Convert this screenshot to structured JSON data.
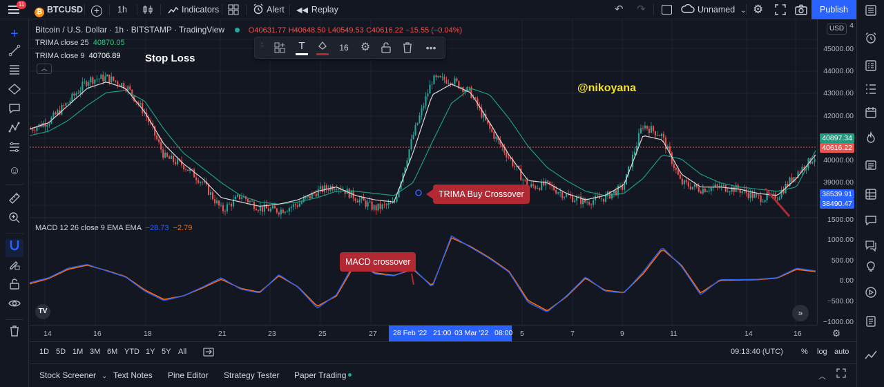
{
  "topbar": {
    "menu_badge": "11",
    "symbol": "BTCUSD",
    "interval": "1h",
    "indicators_label": "Indicators",
    "alert_label": "Alert",
    "replay_label": "Replay",
    "layout_name": "Unnamed",
    "publish_label": "Publish"
  },
  "legend": {
    "title": "Bitcoin / U.S. Dollar · 1h · BITSTAMP · TradingView",
    "open": "O40631.77",
    "high": "H40648.50",
    "low": "L40549.53",
    "close": "C40616.22",
    "change": "−15.55 (−0.04%)",
    "trima25_label": "TRIMA close 25",
    "trima25_value": "40870.05",
    "trima9_label": "TRIMA close 9",
    "trima9_value": "40706.89",
    "macd_label": "MACD 12 26 close 9 EMA EMA",
    "macd_v1": "−28.73",
    "macd_v2": "−2.79"
  },
  "drawing_toolbar": {
    "font_size": "16"
  },
  "annotations": {
    "stop_loss": "Stop Loss",
    "author": "@nikoyana",
    "trima_buy": "TRIMA Buy Crossover",
    "macd_cross": "MACD crossover"
  },
  "price_scale": {
    "currency": "USD",
    "labels": [
      "4",
      "45000.00",
      "44000.00",
      "43000.00",
      "42000.00",
      "40000.00",
      "39000.00",
      "1500.00"
    ],
    "tag_trima25": "40897.34",
    "tag_close": "40616.22",
    "tag_a": "38539.91",
    "tag_b": "38490.47",
    "macd_labels": [
      "1000.00",
      "500.00",
      "0.00",
      "−500.00",
      "−1000.00"
    ]
  },
  "time_scale": {
    "labels": [
      "14",
      "16",
      "18",
      "21",
      "23",
      "25",
      "27",
      "5",
      "7",
      "9",
      "11",
      "14",
      "16"
    ],
    "range_start": "28 Feb '22   21:00",
    "range_end": "03 Mar '22   08:00"
  },
  "range_bar": {
    "ranges": [
      "1D",
      "5D",
      "1M",
      "3M",
      "6M",
      "YTD",
      "1Y",
      "5Y",
      "All"
    ],
    "clock": "09:13:40 (UTC)",
    "percent": "%",
    "log": "log",
    "auto": "auto"
  },
  "bottom_tabs": [
    "Stock Screener",
    "Text Notes",
    "Pine Editor",
    "Strategy Tester",
    "Paper Trading"
  ],
  "colors": {
    "bg": "#131722",
    "up": "#26a69a",
    "down": "#ef5350",
    "trima25": "#1e9c82",
    "trima9": "#e0d7d7",
    "macd": "#2962ff",
    "signal": "#ff6d00",
    "accent": "#2962ff",
    "annot": "#b22833"
  },
  "chart_data": {
    "type": "candlestick",
    "timeframe": "1h",
    "price_range": [
      37800,
      45600
    ],
    "price_close_path": [
      41900,
      42300,
      43200,
      44200,
      44300,
      43900,
      42600,
      40600,
      40200,
      39400,
      38100,
      38800,
      38200,
      38100,
      38400,
      39000,
      39300,
      38700,
      38200,
      38400,
      41600,
      44200,
      44200,
      43600,
      41900,
      40600,
      39200,
      39300,
      38800,
      38500,
      38700,
      39200,
      42100,
      41600,
      39400,
      39100,
      39200,
      39100,
      38700,
      38700,
      39800,
      40600
    ],
    "trima9": [
      41900,
      42200,
      43000,
      43800,
      44100,
      43800,
      42700,
      41200,
      40300,
      39600,
      38700,
      38500,
      38300,
      38400,
      38600,
      39000,
      39200,
      38800,
      38600,
      38500,
      40800,
      43500,
      44000,
      43600,
      42200,
      40700,
      39500,
      39400,
      38900,
      38600,
      38800,
      39300,
      41600,
      41400,
      39800,
      39200,
      39200,
      39100,
      38900,
      38800,
      39600,
      40700
    ],
    "trima25": [
      41600,
      41800,
      42300,
      43000,
      43600,
      43700,
      43200,
      41900,
      40800,
      40100,
      39400,
      38800,
      38500,
      38400,
      38500,
      38700,
      39000,
      39000,
      38900,
      38800,
      39400,
      41300,
      43100,
      43800,
      43500,
      42400,
      41100,
      40100,
      39500,
      39000,
      38800,
      38900,
      39600,
      40700,
      40500,
      39800,
      39400,
      39200,
      39100,
      39000,
      39200,
      40900
    ],
    "macd_range": [
      -1100,
      1350
    ],
    "macd": [
      -30,
      100,
      350,
      450,
      280,
      120,
      -250,
      -500,
      -380,
      -150,
      100,
      -200,
      -300,
      180,
      -150,
      -700,
      -350,
      550,
      200,
      150,
      350,
      -150,
      1200,
      900,
      600,
      250,
      -550,
      -800,
      -380,
      120,
      -250,
      -300,
      250,
      900,
      400,
      -350,
      50,
      50,
      60,
      100,
      350,
      280
    ],
    "signal": [
      -60,
      80,
      320,
      430,
      290,
      130,
      -220,
      -470,
      -380,
      -170,
      60,
      -180,
      -280,
      150,
      -140,
      -650,
      -380,
      480,
      230,
      160,
      320,
      -120,
      1150,
      920,
      620,
      270,
      -500,
      -770,
      -400,
      90,
      -230,
      -290,
      200,
      850,
      430,
      -300,
      30,
      40,
      50,
      90,
      320,
      260
    ],
    "x_labels": [
      "14",
      "16",
      "18",
      "21",
      "23",
      "25",
      "27",
      "5",
      "7",
      "9",
      "11",
      "14",
      "16"
    ]
  }
}
